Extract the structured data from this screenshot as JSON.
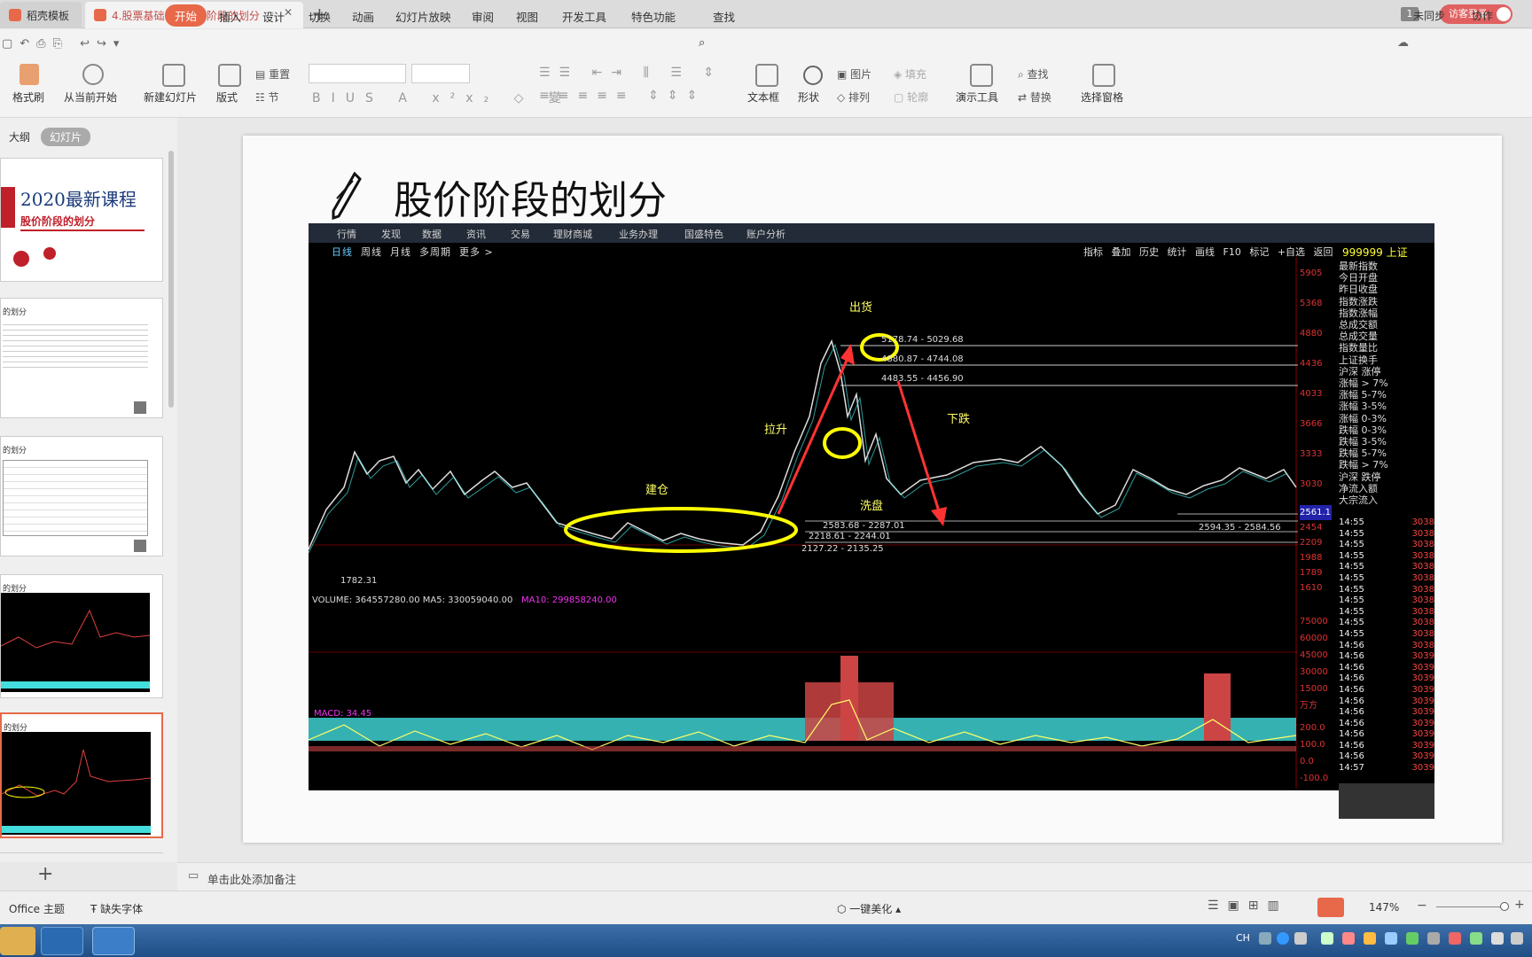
{
  "tabs": {
    "tab1": "稻壳模板",
    "tab2": "4.股票基础公...股价阶段的划分",
    "new_tab": "+"
  },
  "window": {
    "page_count": "1",
    "login": "访客登录"
  },
  "menu": {
    "start": "开始",
    "insert": "插入",
    "design": "设计",
    "switch": "切换",
    "animation": "动画",
    "slideshow": "幻灯片放映",
    "review": "审阅",
    "view": "视图",
    "devtools": "开发工具",
    "special": "特色功能",
    "search": "查找",
    "sync": "未同步",
    "collab": "协作"
  },
  "ribbon": {
    "format_painter": "格式刷",
    "from_current": "从当前开始",
    "new_slide": "新建幻灯片",
    "layout": "版式",
    "reset": "重置",
    "section": "节",
    "textbox": "文本框",
    "shape": "形状",
    "picture": "图片",
    "fill": "填充",
    "arrange": "排列",
    "outline": "轮廓",
    "presenter": "演示工具",
    "find": "查找",
    "replace": "替换",
    "select_pane": "选择窗格"
  },
  "leftpanel": {
    "outline_tab": "大纲",
    "slides_tab": "幻灯片",
    "add_slide": "+"
  },
  "thumbs": [
    {
      "title": "2020最新课程",
      "subtitle": "股价阶段的划分"
    },
    {
      "title": "的划分"
    },
    {
      "title": "的划分"
    },
    {
      "title": "的划分"
    },
    {
      "title": "的划分"
    }
  ],
  "slide": {
    "title": "股价阶段的划分"
  },
  "stock": {
    "nav": [
      "行情",
      "发现",
      "数据",
      "资讯",
      "交易",
      "理财商城",
      "业务办理",
      "国盛特色",
      "账户分析"
    ],
    "periods": [
      "日线",
      "周线",
      "月线",
      "多周期",
      "更多 >"
    ],
    "tools": [
      "指标",
      "叠加",
      "历史",
      "统计",
      "画线",
      "F10",
      "标记",
      "+自选",
      "返回"
    ],
    "code": "999999 上证",
    "right_stats": [
      "最新指数",
      "今日开盘",
      "昨日收盘",
      "指数涨跌",
      "指数涨幅",
      "总成交额",
      "总成交量",
      "指数量比",
      "上证换手",
      "沪深 涨停",
      "涨幅 > 7%",
      "涨幅 5-7%",
      "涨幅 3-5%",
      "涨幅 0-3%",
      "跌幅 0-3%",
      "跌幅 3-5%",
      "跌幅 5-7%",
      "跌幅 > 7%",
      "沪深 跌停",
      "净流入额",
      "大宗流入"
    ],
    "price_axis": [
      "5905",
      "5368",
      "4880",
      "4436",
      "4033",
      "3666",
      "3333",
      "3030",
      "2561.1",
      "2454",
      "2209",
      "1988",
      "1789",
      "1610"
    ],
    "volume_axis": [
      "75000",
      "60000",
      "45000",
      "30000",
      "15000",
      "万方"
    ],
    "macd_axis": [
      "200.0",
      "100.0",
      "0.0",
      "-100.0"
    ],
    "labels": {
      "out": "出货",
      "up": "拉升",
      "down": "下跌",
      "build": "建仓",
      "wash": "洗盘",
      "lv1": "5178.74 - 5029.68",
      "lv2": "4880.87 - 4744.08",
      "lv3": "4483.55 - 4456.90",
      "lv4": "2583.68 - 2287.01",
      "lv5": "2218.61 - 2244.01",
      "lv6": "2127.22 - 2135.25",
      "lv7": "2594.35 - 2584.56",
      "low": "1782.31",
      "volume": "VOLUME: 364557280.00  MA5: 330059040.00",
      "ma10": "MA10: 299858240.00",
      "macd": "MACD: 34.45"
    },
    "ticks_time": [
      "14:55",
      "14:55",
      "14:55",
      "14:55",
      "14:55",
      "14:55",
      "14:55",
      "14:55",
      "14:55",
      "14:55",
      "14:55",
      "14:56",
      "14:56",
      "14:56",
      "14:56",
      "14:56",
      "14:56",
      "14:56",
      "14:56",
      "14:56",
      "14:56",
      "14:56",
      "14:57"
    ],
    "ticks_price": [
      "3038",
      "3038",
      "3038",
      "3038",
      "3038",
      "3038",
      "3038",
      "3038",
      "3038",
      "3038",
      "3038",
      "3038",
      "3039",
      "3039",
      "3039",
      "3039",
      "3039",
      "3039",
      "3039",
      "3039",
      "3039",
      "3039",
      "3039"
    ]
  },
  "notes": {
    "placeholder": "单击此处添加备注"
  },
  "status": {
    "theme": "Office 主题",
    "missing_font": "缺失字体",
    "beautify": "一键美化",
    "zoom": "147%"
  },
  "tray": {
    "lang": "CH"
  }
}
